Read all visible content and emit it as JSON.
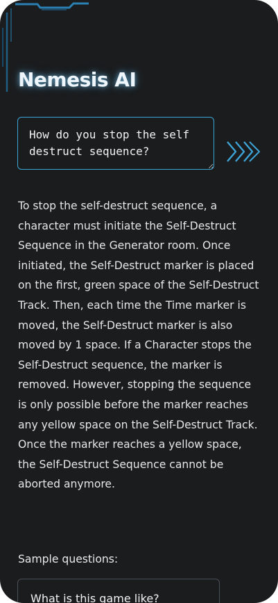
{
  "app": {
    "title": "Nemesis AI"
  },
  "query": {
    "value": "How do you stop the self destruct sequence?",
    "submit_icon": "triple-chevron-right-icon"
  },
  "answer": {
    "text": "To stop the self-destruct sequence, a character must initiate the Self-Destruct Sequence in the Generator room. Once initiated, the Self-Destruct marker is placed on the first, green space of the Self-Destruct Track. Then, each time the Time marker is moved, the Self-Destruct marker is also moved by 1 space. If a Character stops the Self-Destruct sequence, the marker is removed. However, stopping the sequence is only possible before the marker reaches any yellow space on the Self-Destruct Track. Once the marker reaches a yellow space, the Self-Destruct Sequence cannot be aborted anymore."
  },
  "samples": {
    "heading": "Sample questions:",
    "items": [
      {
        "label": "What is this game like?"
      }
    ]
  },
  "colors": {
    "background": "#1b1c1d",
    "accent": "#3da4d8",
    "text": "#e4e6e8",
    "sample_border": "#4a5058"
  }
}
